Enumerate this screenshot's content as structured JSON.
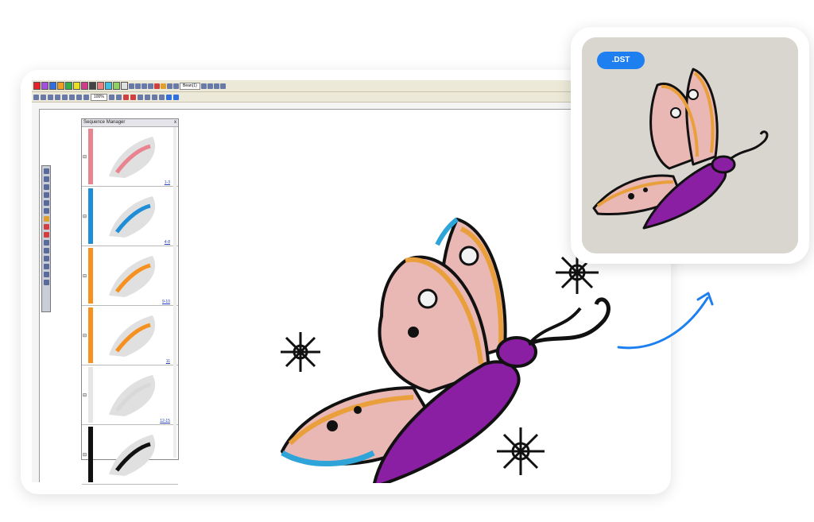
{
  "app": {
    "toolbar": {
      "zoom_value": "100%",
      "combo_value": "Bean(1)"
    },
    "sequence_manager": {
      "title": "Sequence Manager",
      "close_label": "x",
      "items": [
        {
          "color": "#e8838f",
          "range": "1-3"
        },
        {
          "color": "#1f8ed6",
          "range": "4-8"
        },
        {
          "color": "#f6901e",
          "range": "9-10"
        },
        {
          "color": "#f6901e",
          "range": "11"
        },
        {
          "color": "#e6e6e6",
          "range": "12-15"
        },
        {
          "color": "#111111",
          "range": ""
        }
      ]
    }
  },
  "file_preview": {
    "badge": ".DST"
  },
  "colors": {
    "accent": "#1e7ff0",
    "thread_pink": "#e9b7b4",
    "thread_purple": "#8a1fa3",
    "thread_orange": "#e9a03c",
    "thread_blue": "#2fa4d8"
  }
}
